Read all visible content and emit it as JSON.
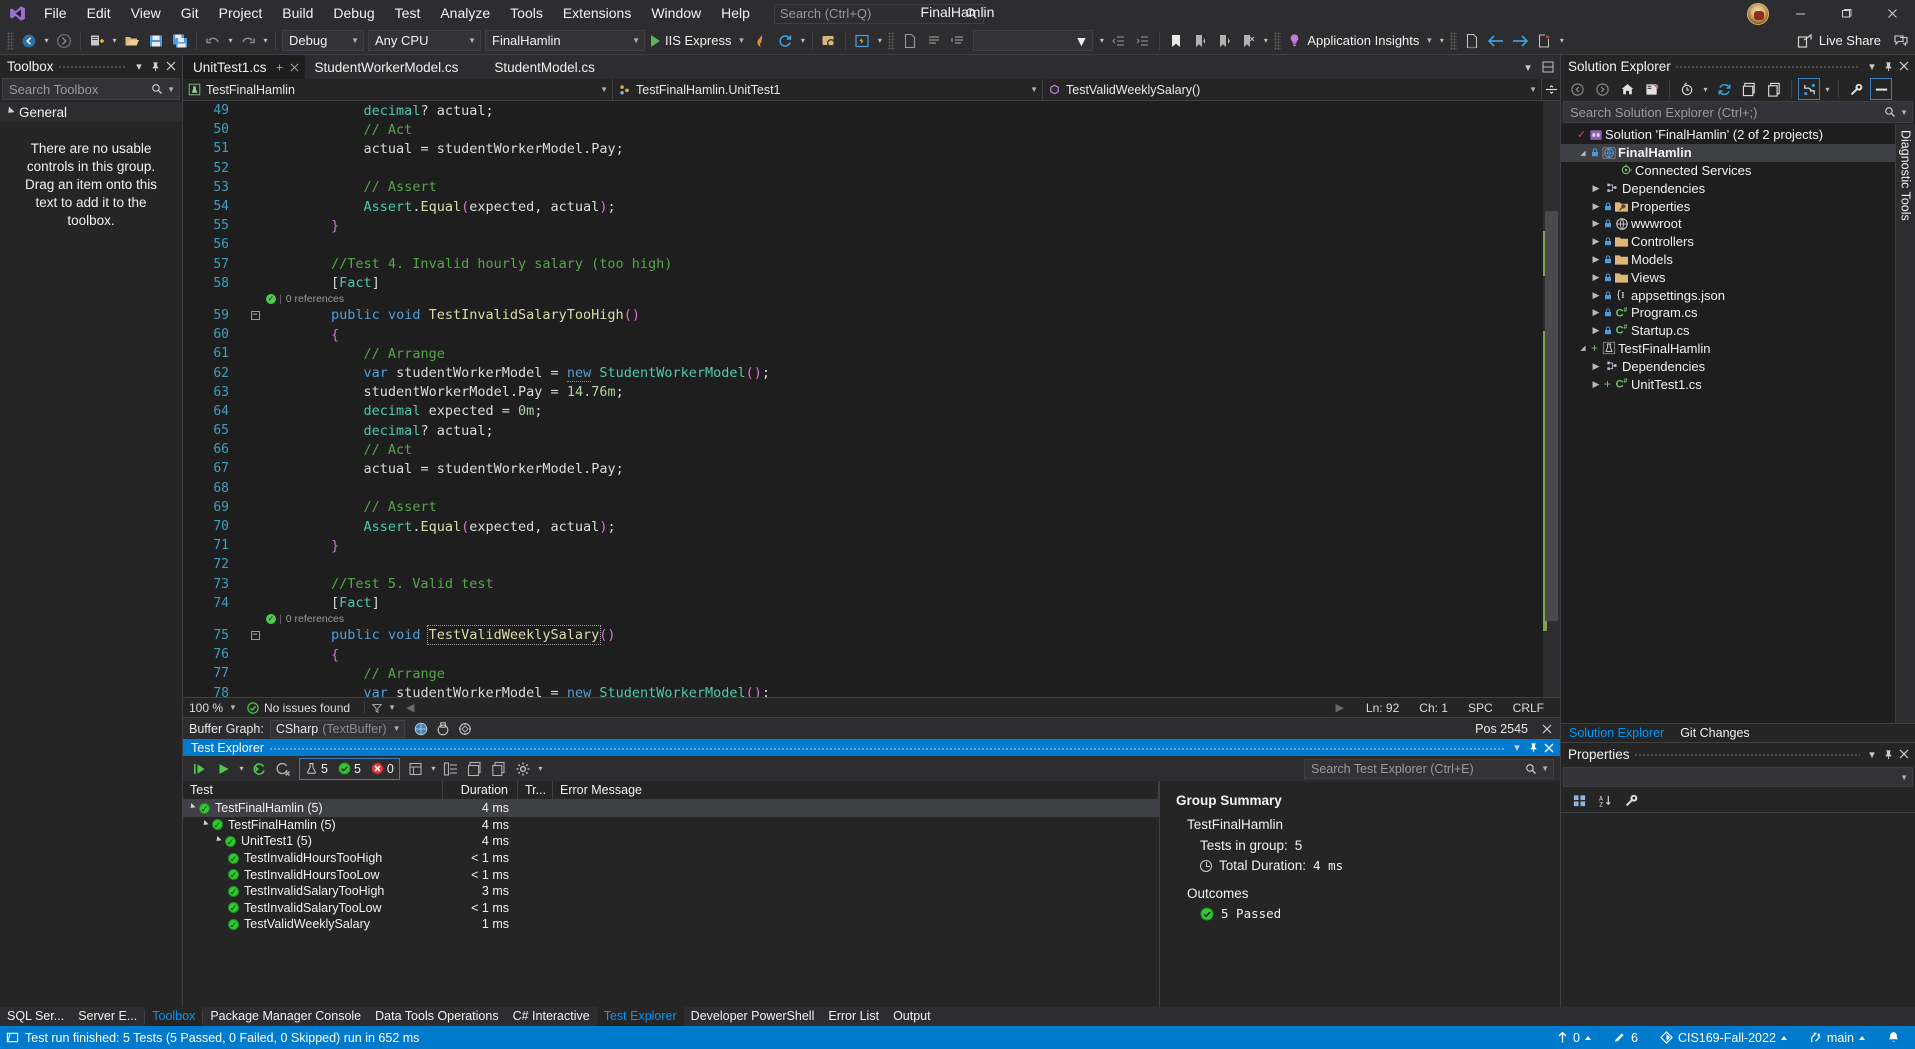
{
  "titlebar": {
    "menus": [
      "File",
      "Edit",
      "View",
      "Git",
      "Project",
      "Build",
      "Debug",
      "Test",
      "Analyze",
      "Tools",
      "Extensions",
      "Window",
      "Help"
    ],
    "search_placeholder": "Search (Ctrl+Q)",
    "window_title": "FinalHamlin",
    "minimize": "—",
    "maximize": "❐",
    "close": "✕"
  },
  "toolbar": {
    "config": "Debug",
    "platform": "Any CPU",
    "startup_project": "FinalHamlin",
    "run_label": "IIS Express",
    "app_insights": "Application Insights",
    "live_share": "Live Share",
    "empty_combo": ""
  },
  "toolbox": {
    "title": "Toolbox",
    "search_placeholder": "Search Toolbox",
    "group": "General",
    "empty_message": "There are no usable controls in this group. Drag an item onto this text to add it to the toolbox."
  },
  "editor": {
    "tabs": [
      {
        "label": "UnitTest1.cs",
        "active": true
      },
      {
        "label": "StudentWorkerModel.cs",
        "active": false
      },
      {
        "label": "StudentModel.cs",
        "active": false
      }
    ],
    "nav": {
      "project": "TestFinalHamlin",
      "type": "TestFinalHamlin.UnitTest1",
      "member": "TestValidWeeklySalary()"
    },
    "codelens_label": "0 references",
    "lines": [
      {
        "n": 49,
        "indent": 3,
        "html": "<span class=\"type\">decimal</span><span class=\"punc\">? </span><span class=\"id\">actual</span><span class=\"punc\">;</span>"
      },
      {
        "n": 50,
        "indent": 3,
        "html": "<span class=\"cmt\">// Act</span>"
      },
      {
        "n": 51,
        "indent": 3,
        "html": "<span class=\"id\">actual</span> <span class=\"punc\">=</span> <span class=\"id\">studentWorkerModel</span><span class=\"punc\">.</span><span class=\"id\">Pay</span><span class=\"punc\">;</span>"
      },
      {
        "n": 52,
        "indent": 0,
        "html": ""
      },
      {
        "n": 53,
        "indent": 3,
        "html": "<span class=\"cmt\">// Assert</span>"
      },
      {
        "n": 54,
        "indent": 3,
        "html": "<span class=\"cls\">Assert</span><span class=\"punc\">.</span><span class=\"mth\">Equal</span><span class=\"par\">(</span><span class=\"id\">expected</span><span class=\"punc\">, </span><span class=\"id\">actual</span><span class=\"par\">)</span><span class=\"punc\">;</span>"
      },
      {
        "n": 55,
        "indent": 2,
        "html": "<span class=\"par\">}</span>"
      },
      {
        "n": 56,
        "indent": 0,
        "html": ""
      },
      {
        "n": 57,
        "indent": 2,
        "html": "<span class=\"cmt\">//Test 4. Invalid hourly salary (too high)</span>"
      },
      {
        "n": 58,
        "indent": 2,
        "html": "<span class=\"punc\">[</span><span class=\"attr\">Fact</span><span class=\"punc\">]</span>"
      },
      {
        "n": 59,
        "indent": 2,
        "fold": true,
        "html": "<span class=\"kw\">public</span> <span class=\"kw\">void</span> <span class=\"mth\">TestInvalidSalaryTooHigh</span><span class=\"par\">()</span>"
      },
      {
        "n": 60,
        "indent": 2,
        "html": "<span class=\"par\">{</span>"
      },
      {
        "n": 61,
        "indent": 3,
        "html": "<span class=\"cmt\">// Arrange</span>"
      },
      {
        "n": 62,
        "indent": 3,
        "html": "<span class=\"kw\">var</span> <span class=\"id\">studentWorkerModel</span> <span class=\"punc\">=</span> <span class=\"kwnew\">new</span> <span class=\"cls\">StudentWorkerModel</span><span class=\"par\">()</span><span class=\"punc\">;</span>"
      },
      {
        "n": 63,
        "indent": 3,
        "html": "<span class=\"id\">studentWorkerModel</span><span class=\"punc\">.</span><span class=\"id\">Pay</span> <span class=\"punc\">=</span> <span class=\"num\">14.76m</span><span class=\"punc\">;</span>"
      },
      {
        "n": 64,
        "indent": 3,
        "html": "<span class=\"type\">decimal</span> <span class=\"id\">expected</span> <span class=\"punc\">=</span> <span class=\"num\">0m</span><span class=\"punc\">;</span>"
      },
      {
        "n": 65,
        "indent": 3,
        "html": "<span class=\"type\">decimal</span><span class=\"punc\">? </span><span class=\"id\">actual</span><span class=\"punc\">;</span>"
      },
      {
        "n": 66,
        "indent": 3,
        "html": "<span class=\"cmt\">// Act</span>"
      },
      {
        "n": 67,
        "indent": 3,
        "html": "<span class=\"id\">actual</span> <span class=\"punc\">=</span> <span class=\"id\">studentWorkerModel</span><span class=\"punc\">.</span><span class=\"id\">Pay</span><span class=\"punc\">;</span>"
      },
      {
        "n": 68,
        "indent": 0,
        "html": ""
      },
      {
        "n": 69,
        "indent": 3,
        "html": "<span class=\"cmt\">// Assert</span>"
      },
      {
        "n": 70,
        "indent": 3,
        "html": "<span class=\"cls\">Assert</span><span class=\"punc\">.</span><span class=\"mth\">Equal</span><span class=\"par\">(</span><span class=\"id\">expected</span><span class=\"punc\">, </span><span class=\"id\">actual</span><span class=\"par\">)</span><span class=\"punc\">;</span>"
      },
      {
        "n": 71,
        "indent": 2,
        "html": "<span class=\"par\">}</span>"
      },
      {
        "n": 72,
        "indent": 0,
        "html": ""
      },
      {
        "n": 73,
        "indent": 2,
        "html": "<span class=\"cmt\">//Test 5. Valid test</span>"
      },
      {
        "n": 74,
        "indent": 2,
        "html": "<span class=\"punc\">[</span><span class=\"attr\">Fact</span><span class=\"punc\">]</span>"
      },
      {
        "n": 75,
        "indent": 2,
        "fold": true,
        "html": "<span class=\"kw\">public</span> <span class=\"kw\">void</span> <span class=\"mth boxsel\">TestValidWeeklySalary</span><span class=\"par\">()</span>"
      },
      {
        "n": 76,
        "indent": 2,
        "html": "<span class=\"par\">{</span>"
      },
      {
        "n": 77,
        "indent": 3,
        "html": "<span class=\"cmt\">// Arrange</span>"
      },
      {
        "n": 78,
        "indent": 3,
        "html": "<span class=\"kw\">var</span> <span class=\"id\">studentWorkerModel</span> <span class=\"punc\">=</span> <span class=\"kwnew\">new</span> <span class=\"cls\">StudentWorkerModel</span><span class=\"par\">()</span><span class=\"punc\">;</span>"
      }
    ],
    "codelens_at": [
      58,
      74
    ],
    "status": {
      "zoom": "100 %",
      "issues": "No issues found",
      "ln": "Ln: 92",
      "ch": "Ch: 1",
      "spaces": "SPC",
      "eol": "CRLF"
    },
    "buffer_graph": {
      "label": "Buffer Graph:",
      "value": "CSharp",
      "value_sub": "(TextBuffer)",
      "pos": "Pos 2545"
    }
  },
  "test_explorer": {
    "title": "Test Explorer",
    "search_placeholder": "Search Test Explorer (Ctrl+E)",
    "counters": {
      "total": "5",
      "passed": "5",
      "failed": "0"
    },
    "columns": [
      "Test",
      "Duration",
      "Tr...",
      "Error Message"
    ],
    "rows": [
      {
        "name": "TestFinalHamlin (5)",
        "duration": "4 ms",
        "depth": 0,
        "group": true,
        "selected": true
      },
      {
        "name": "TestFinalHamlin (5)",
        "duration": "4 ms",
        "depth": 1,
        "group": true,
        "selected": false
      },
      {
        "name": "UnitTest1 (5)",
        "duration": "4 ms",
        "depth": 2,
        "group": true,
        "selected": false
      },
      {
        "name": "TestInvalidHoursTooHigh",
        "duration": "< 1 ms",
        "depth": 3,
        "group": false,
        "selected": false
      },
      {
        "name": "TestInvalidHoursTooLow",
        "duration": "< 1 ms",
        "depth": 3,
        "group": false,
        "selected": false
      },
      {
        "name": "TestInvalidSalaryTooHigh",
        "duration": "3 ms",
        "depth": 3,
        "group": false,
        "selected": false
      },
      {
        "name": "TestInvalidSalaryTooLow",
        "duration": "< 1 ms",
        "depth": 3,
        "group": false,
        "selected": false
      },
      {
        "name": "TestValidWeeklySalary",
        "duration": "1 ms",
        "depth": 3,
        "group": false,
        "selected": false
      }
    ],
    "summary": {
      "title": "Group Summary",
      "group_name": "TestFinalHamlin",
      "tests_in_group_label": "Tests in group:",
      "tests_in_group_value": "5",
      "total_duration_label": "Total Duration:",
      "total_duration_value": "4  ms",
      "outcomes_label": "Outcomes",
      "outcome_value": "5  Passed"
    }
  },
  "solution_explorer": {
    "title": "Solution Explorer",
    "search_placeholder": "Search Solution Explorer (Ctrl+;)",
    "tree": [
      {
        "label": "Solution 'FinalHamlin' (2 of 2 projects)",
        "depth": 0,
        "icon": "solution",
        "expander": "none",
        "check": true,
        "selected": false,
        "bold": false
      },
      {
        "label": "FinalHamlin",
        "depth": 1,
        "icon": "web-project",
        "expander": "open",
        "lock": true,
        "selected": true,
        "bold": true
      },
      {
        "label": "Connected Services",
        "depth": 3,
        "icon": "connected-services",
        "expander": "none",
        "selected": false,
        "bold": false
      },
      {
        "label": "Dependencies",
        "depth": 2,
        "icon": "dependencies",
        "expander": "closed",
        "selected": false,
        "bold": false
      },
      {
        "label": "Properties",
        "depth": 2,
        "icon": "properties-folder",
        "expander": "closed",
        "lock": true,
        "selected": false,
        "bold": false
      },
      {
        "label": "wwwroot",
        "depth": 2,
        "icon": "globe",
        "expander": "closed",
        "lock": true,
        "selected": false,
        "bold": false
      },
      {
        "label": "Controllers",
        "depth": 2,
        "icon": "folder",
        "expander": "closed",
        "lock": true,
        "selected": false,
        "bold": false
      },
      {
        "label": "Models",
        "depth": 2,
        "icon": "folder",
        "expander": "closed",
        "lock": true,
        "selected": false,
        "bold": false
      },
      {
        "label": "Views",
        "depth": 2,
        "icon": "folder",
        "expander": "closed",
        "lock": true,
        "selected": false,
        "bold": false
      },
      {
        "label": "appsettings.json",
        "depth": 2,
        "icon": "json",
        "expander": "closed",
        "lock": true,
        "selected": false,
        "bold": false
      },
      {
        "label": "Program.cs",
        "depth": 2,
        "icon": "csharp",
        "expander": "closed",
        "lock": true,
        "selected": false,
        "bold": false
      },
      {
        "label": "Startup.cs",
        "depth": 2,
        "icon": "csharp",
        "expander": "closed",
        "lock": true,
        "selected": false,
        "bold": false
      },
      {
        "label": "TestFinalHamlin",
        "depth": 1,
        "icon": "test-project",
        "expander": "open",
        "plus": true,
        "selected": false,
        "bold": false
      },
      {
        "label": "Dependencies",
        "depth": 2,
        "icon": "dependencies",
        "expander": "closed",
        "selected": false,
        "bold": false
      },
      {
        "label": "UnitTest1.cs",
        "depth": 2,
        "icon": "csharp",
        "expander": "closed",
        "plus": true,
        "selected": false,
        "bold": false
      }
    ],
    "dock_tabs": [
      {
        "label": "Solution Explorer",
        "active": true
      },
      {
        "label": "Git Changes",
        "active": false
      }
    ]
  },
  "properties": {
    "title": "Properties"
  },
  "diagnostic_tools": {
    "label": "Diagnostic Tools"
  },
  "bottom_tabs": [
    {
      "label": "SQL Ser...",
      "state": "normal"
    },
    {
      "label": "Server E...",
      "state": "normal"
    },
    {
      "label": "Toolbox",
      "state": "accent"
    },
    {
      "label": "Package Manager Console",
      "state": "normal"
    },
    {
      "label": "Data Tools Operations",
      "state": "normal"
    },
    {
      "label": "C# Interactive",
      "state": "normal"
    },
    {
      "label": "Test Explorer",
      "state": "accent"
    },
    {
      "label": "Developer PowerShell",
      "state": "normal"
    },
    {
      "label": "Error List",
      "state": "normal"
    },
    {
      "label": "Output",
      "state": "normal"
    }
  ],
  "statusbar": {
    "message": "Test run finished: 5 Tests (5 Passed, 0 Failed, 0 Skipped) run in 652 ms",
    "outgoing": "0",
    "pending_changes": "6",
    "repo": "CIS169-Fall-2022",
    "branch": "main"
  },
  "colors": {
    "accent": "#007acc",
    "pass_green": "#31c831",
    "fail_red": "#e04343",
    "saved_gutter": "#7fa34f",
    "link_blue": "#0097fb"
  }
}
